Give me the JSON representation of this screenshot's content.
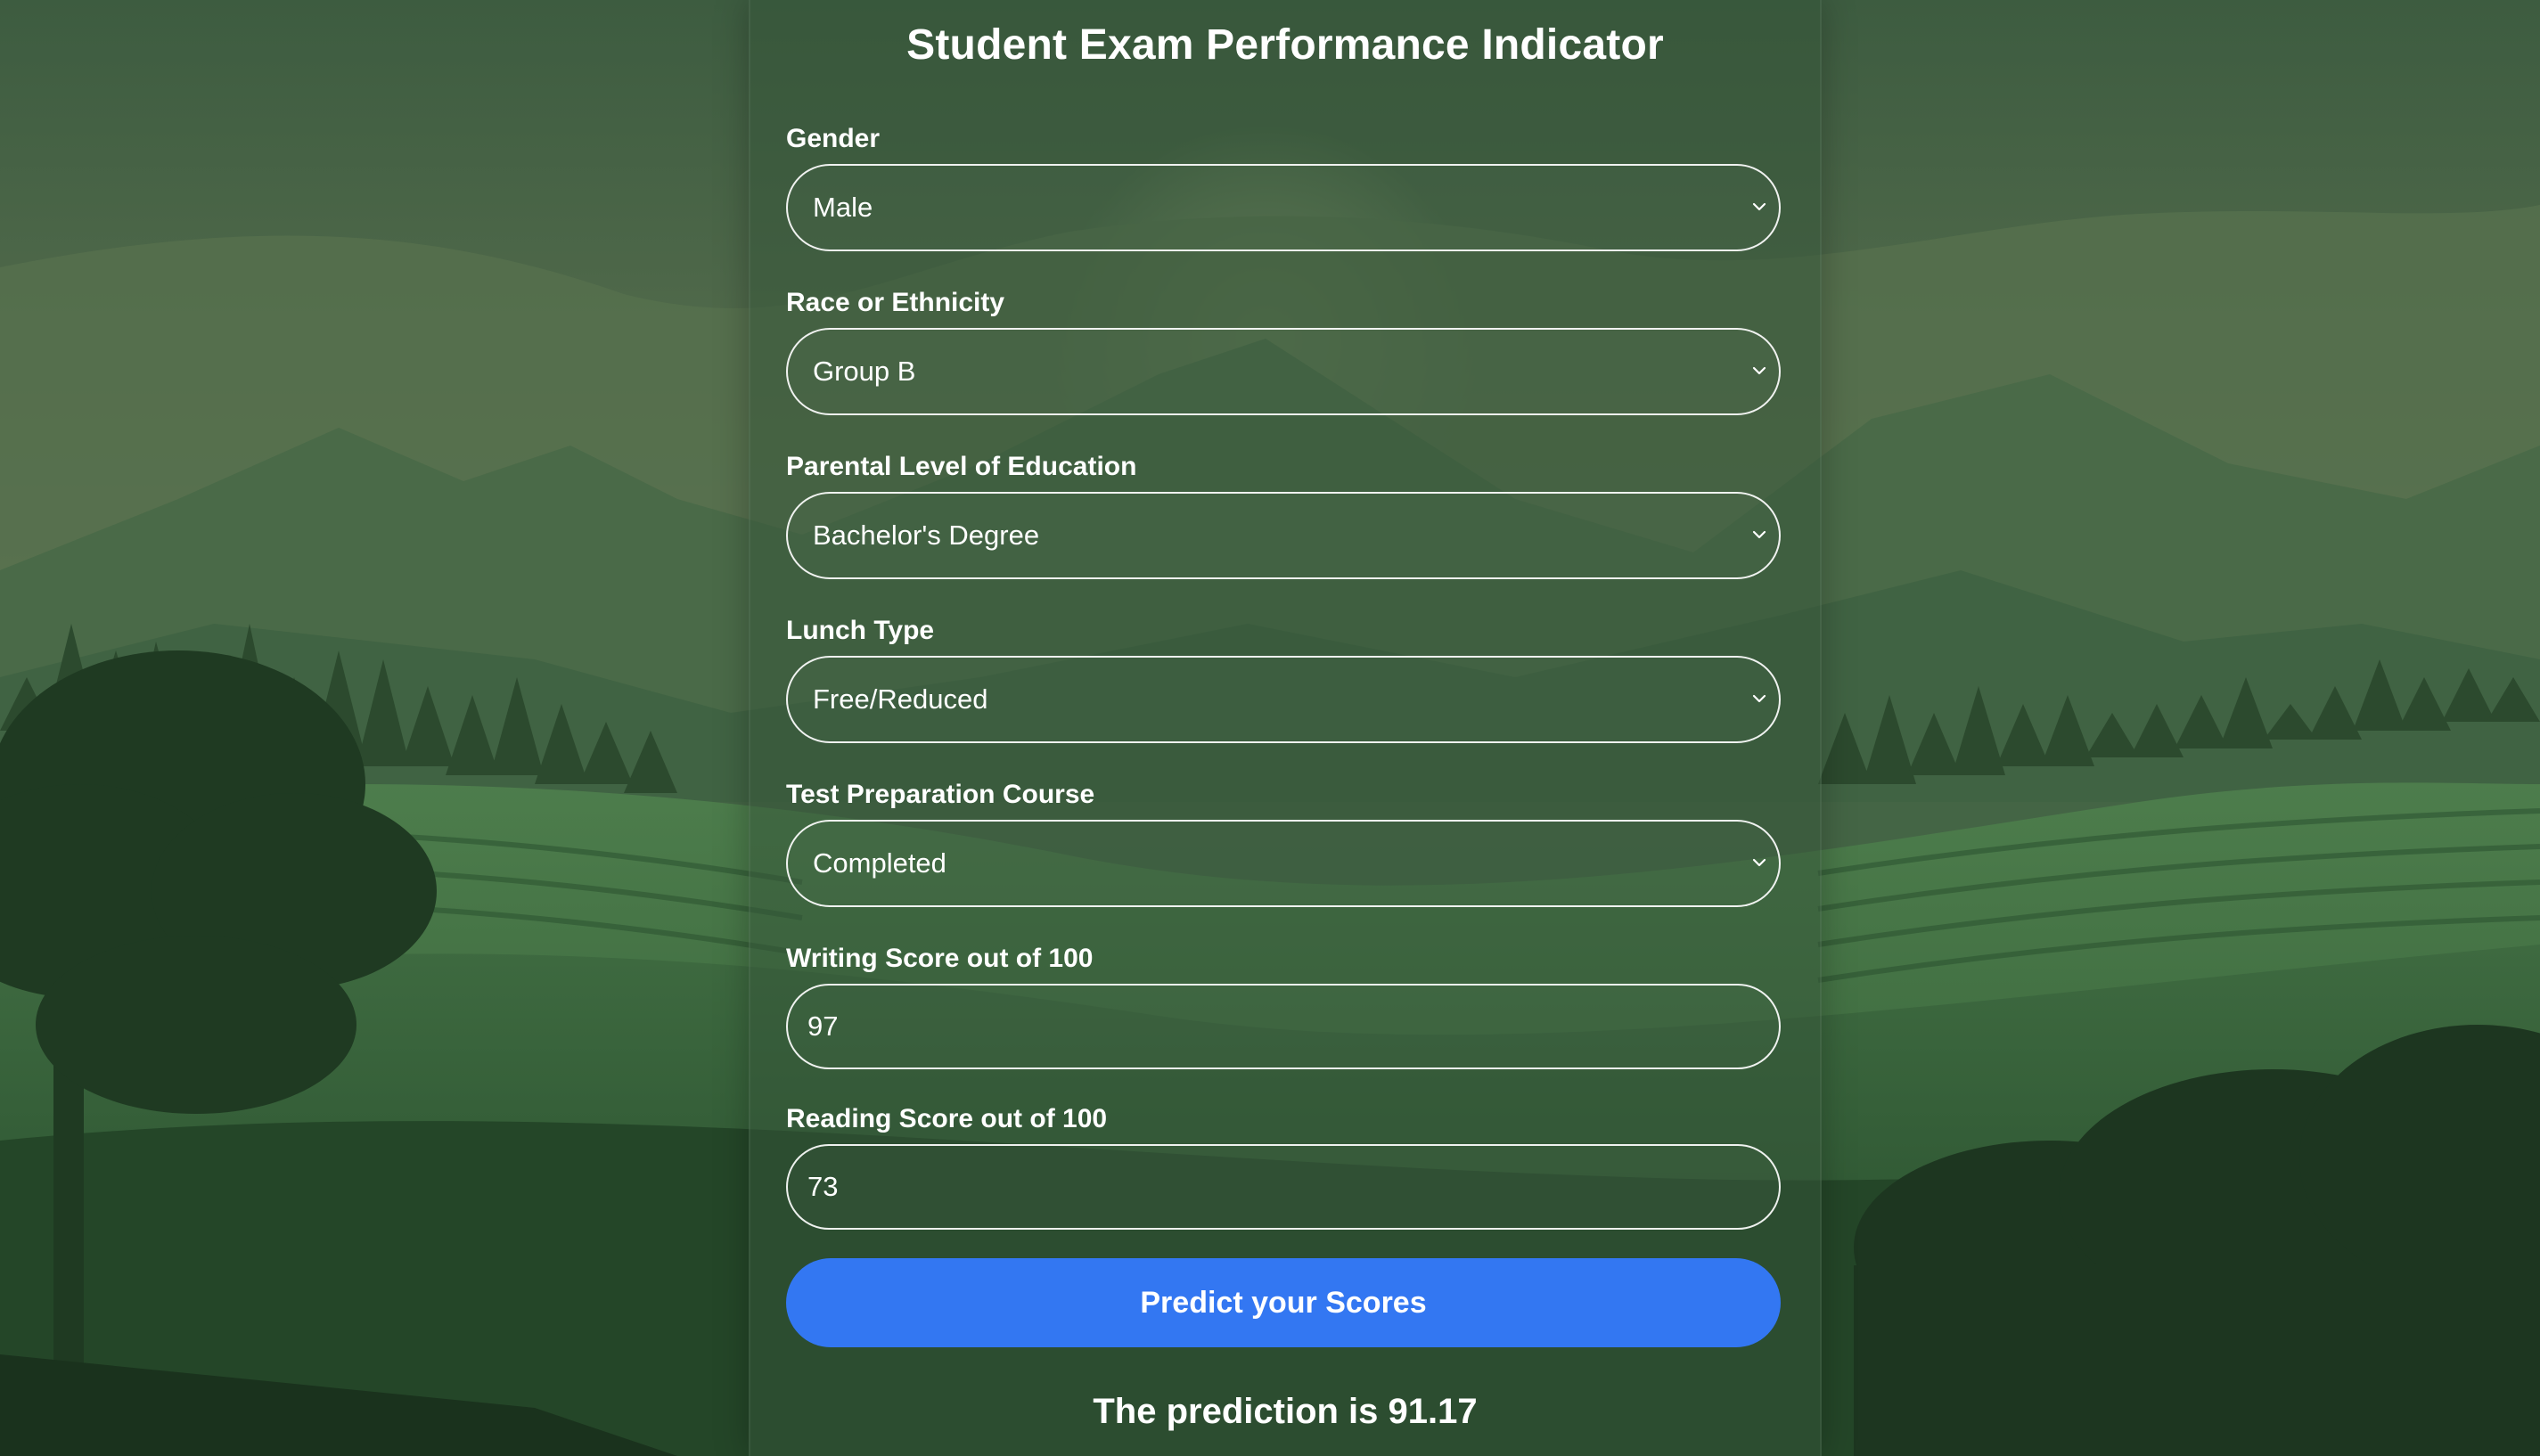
{
  "page": {
    "title": "Student Exam Performance Indicator"
  },
  "form": {
    "gender": {
      "label": "Gender",
      "value": "Male"
    },
    "race": {
      "label": "Race or Ethnicity",
      "value": "Group B"
    },
    "parental_education": {
      "label": "Parental Level of Education",
      "value": "Bachelor's Degree"
    },
    "lunch": {
      "label": "Lunch Type",
      "value": "Free/Reduced"
    },
    "test_prep": {
      "label": "Test Preparation Course",
      "value": "Completed"
    },
    "writing": {
      "label": "Writing Score out of 100",
      "value": "97"
    },
    "reading": {
      "label": "Reading Score out of 100",
      "value": "73"
    },
    "submit_label": "Predict your Scores"
  },
  "result": {
    "text": "The prediction is 91.17"
  },
  "colors": {
    "button": "#3377f2",
    "text": "#ffffff",
    "background": "#2f4a33"
  },
  "icons": {
    "dropdown": "chevron-down-icon"
  }
}
